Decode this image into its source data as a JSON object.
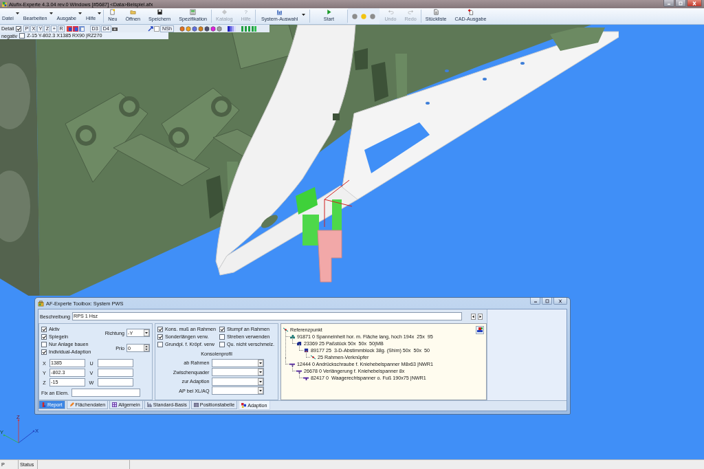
{
  "window": {
    "title": "Alufix-Experte 4.3.04 rev.0 Windows [#5687] <Data>Beispiel.afx"
  },
  "toolbar": {
    "groups": [
      {
        "items": [
          {
            "kind": "menu",
            "label": "Datei"
          },
          {
            "kind": "menu",
            "label": "Bearbeiten"
          },
          {
            "kind": "menu",
            "label": "Ausgabe"
          },
          {
            "kind": "menu",
            "label": "Hilfe"
          }
        ]
      },
      {
        "items": [
          {
            "kind": "button",
            "label": "Neu",
            "disabled": false
          },
          {
            "kind": "button",
            "label": "Öffnen",
            "disabled": false
          },
          {
            "kind": "button",
            "label": "Speichern",
            "disabled": false
          },
          {
            "kind": "button",
            "label": "Spezifikation",
            "disabled": false
          }
        ]
      },
      {
        "items": [
          {
            "kind": "button",
            "label": "Katalog",
            "disabled": true
          },
          {
            "kind": "button",
            "label": "Hilfe",
            "glyph": "?",
            "disabled": true
          }
        ]
      },
      {
        "items": [
          {
            "kind": "split",
            "label": "System-Auswahl",
            "disabled": false
          }
        ]
      },
      {
        "items": [
          {
            "kind": "button",
            "label": "Start",
            "disabled": false
          }
        ]
      },
      {
        "items": [
          {
            "kind": "lights",
            "lights": [
              {
                "color": "#8c8c8c"
              },
              {
                "color": "#f2c311"
              },
              {
                "color": "#8c8c8c"
              }
            ]
          },
          {
            "kind": "button",
            "label": "Undo",
            "disabled": true
          },
          {
            "kind": "button",
            "label": "Redo",
            "disabled": true
          }
        ]
      },
      {
        "items": [
          {
            "kind": "button",
            "label": "Stückliste",
            "disabled": false
          },
          {
            "kind": "button",
            "label": "CAD-Ausgabe",
            "disabled": false
          }
        ]
      }
    ]
  },
  "view_toolbar": {
    "label": "Detail",
    "checked": true,
    "axis_buttons": [
      {
        "label": "P"
      },
      {
        "label": "X"
      },
      {
        "label": "Y"
      },
      {
        "label": "Z"
      },
      {
        "label": "+"
      },
      {
        "label": "R"
      }
    ],
    "view_buttons": [
      {
        "label": "D3"
      },
      {
        "label": "D4"
      }
    ],
    "filter_button": {
      "label": "NSh"
    }
  },
  "position_bar": {
    "label": "negativ",
    "checked": false,
    "value": "Z-15 Y-802.3 X1385 RX90 |RZ270"
  },
  "axis_triad": {
    "labels": [
      "Z",
      "X",
      "Y"
    ]
  },
  "dialog": {
    "title": "AF-Experte Toolbox: System PWS",
    "description": {
      "label": "Beschreibung",
      "value": "RPS 1 Hsz"
    },
    "options": [
      {
        "label": "Aktiv",
        "checked": true
      },
      {
        "label": "Spiegeln",
        "checked": true
      },
      {
        "label": "Nur Anlage bauen",
        "checked": false
      },
      {
        "label": "Individual-Adaption",
        "checked": true
      }
    ],
    "direction": {
      "label": "Richtung",
      "value": "-Y"
    },
    "priority": {
      "label": "Prio",
      "value": "0"
    },
    "coordinates": [
      {
        "label": "X",
        "value": "1385"
      },
      {
        "label": "Y",
        "value": "-802.3"
      },
      {
        "label": "Z",
        "value": "-15"
      }
    ],
    "rotations": [
      {
        "label": "U"
      },
      {
        "label": "V"
      },
      {
        "label": "W"
      }
    ],
    "fix_element": {
      "label": "Fix an Elem."
    },
    "console_options": [
      {
        "label": "Kons. muß an Rahmen",
        "checked": true
      },
      {
        "label": "Stumpf an Rahmen",
        "checked": true
      },
      {
        "label": "Sonderlängen verw.",
        "checked": true
      },
      {
        "label": "Streben verwenden",
        "checked": false
      },
      {
        "label": "Grundpl. f. Kröpf. verw",
        "checked": false
      },
      {
        "label": "Qu. nicht verschmelz.",
        "checked": false
      }
    ],
    "console_profile": {
      "title": "Konsolenprofil",
      "fields": [
        {
          "label": "ab Rahmen"
        },
        {
          "label": "Zwischenquader"
        },
        {
          "label": "zur Adaption"
        },
        {
          "label": "AP bei XL/AQ"
        }
      ]
    },
    "tree": [
      {
        "kind": "point",
        "label": "Referenzpunkt",
        "children": [
          {
            "kind": "unit",
            "label": "91871 0 Spanneinheit hor. m. Fläche lang, hoch 194x  25x  95",
            "children": [
              {
                "kind": "spacer",
                "label": "23369 25 Paßstück 50x  50x  50|MB",
                "children": [
                  {
                    "kind": "block",
                    "label": "89177 25  3-D-Abstimmblock 38g. (Shim) 50x  50x  50",
                    "children": [
                      {
                        "kind": "point",
                        "label": "25 Rahmen-Verknüpfer"
                      }
                    ]
                  }
                ]
              }
            ]
          },
          {
            "kind": "clamp",
            "label": "12444 0 Andrückschraube f. Kniehebelspanner M8x63 |NWR1",
            "children": [
              {
                "kind": "clamp",
                "label": "26678 0 Verlängerung f. Kniehebelspanner 8x",
                "children": [
                  {
                    "kind": "clamp",
                    "label": "82417 0  Waagerechtspanner o. Fuß 190x75 |NWR1"
                  }
                ]
              }
            ]
          }
        ]
      }
    ],
    "tabs": [
      {
        "label": "Report",
        "selected": false,
        "highlighted": true
      },
      {
        "label": "Flächendaten",
        "selected": false,
        "highlighted": false
      },
      {
        "label": "Allgemein",
        "selected": false,
        "highlighted": false
      },
      {
        "label": "Standard-Basis",
        "selected": false,
        "highlighted": false
      },
      {
        "label": "Positionstabelle",
        "selected": false,
        "highlighted": false
      },
      {
        "label": "Adaption",
        "selected": true,
        "highlighted": false
      }
    ]
  },
  "status_bar": {
    "fields": [
      {
        "text": "P"
      },
      {
        "text": "Status"
      }
    ]
  }
}
